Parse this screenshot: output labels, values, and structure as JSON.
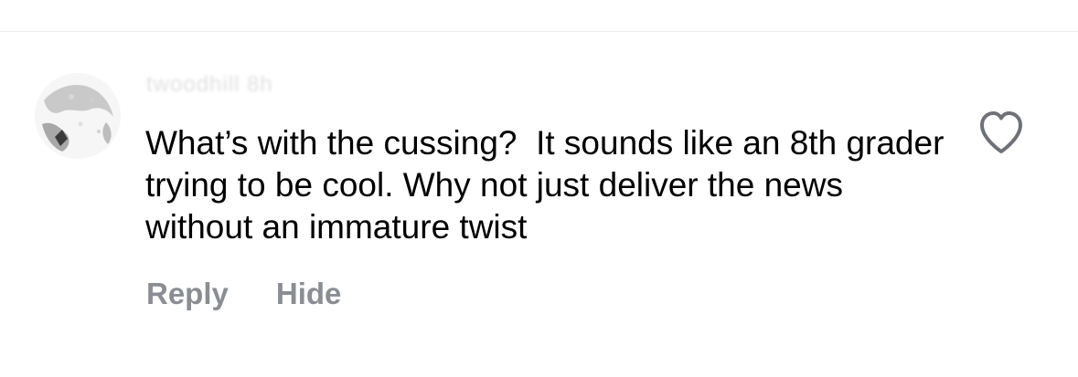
{
  "comment": {
    "username": "twoodhill 8h",
    "text": "What’s with the cussing?  It sounds like an 8th grader trying to be cool. Why not just deliver the news without an immature twist"
  },
  "actions": {
    "reply_label": "Reply",
    "hide_label": "Hide"
  },
  "icons": {
    "like": "heart-outline-icon"
  },
  "colors": {
    "text": "#000000",
    "action": "#8a8d93",
    "icon": "#6e7178",
    "divider": "#ececec"
  }
}
